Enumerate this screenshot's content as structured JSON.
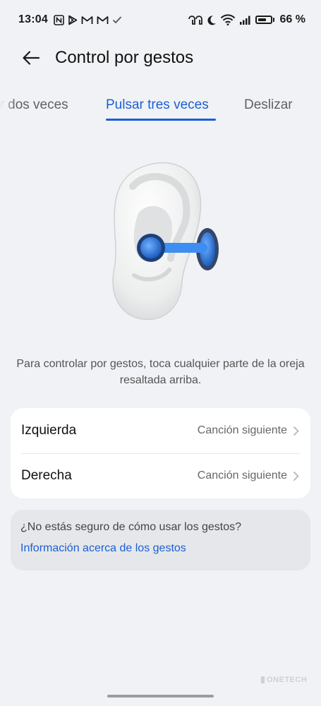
{
  "status_bar": {
    "time": "13:04",
    "battery_text": "66 %",
    "battery_level": 0.66,
    "left_icons": [
      "nfc-icon",
      "play-store-icon",
      "gmail-icon",
      "gmail-icon",
      "check-icon"
    ],
    "right_icons": [
      "earbuds-icon",
      "moon-icon",
      "wifi-icon",
      "signal-icon"
    ]
  },
  "header": {
    "title": "Control por gestos",
    "back_icon": "arrow-left-icon"
  },
  "tabs": [
    {
      "label": "Pulsar dos veces",
      "active": false
    },
    {
      "label": "Pulsar tres veces",
      "active": true
    },
    {
      "label": "Deslizar",
      "active": false
    }
  ],
  "hint_text": "Para controlar por gestos, toca cualquier parte de la oreja resaltada arriba.",
  "settings": {
    "rows": [
      {
        "label": "Izquierda",
        "value": "Canción siguiente"
      },
      {
        "label": "Derecha",
        "value": "Canción siguiente"
      }
    ]
  },
  "help": {
    "question": "¿No estás seguro de cómo usar los gestos?",
    "link": "Información acerca de los gestos"
  },
  "watermark": "ONETECH",
  "colors": {
    "accent": "#1a5fd6",
    "background": "#f1f2f5",
    "card": "#ffffff",
    "earbud": "#2f7de0"
  }
}
